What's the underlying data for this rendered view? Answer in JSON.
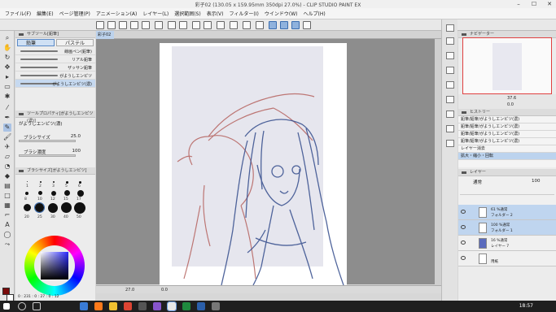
{
  "window": {
    "title": "彩子02 (130.05 x 159.95mm 350dpi 27.0%)  - CLIP STUDIO PAINT EX"
  },
  "menu": [
    "ファイル(F)",
    "編集(E)",
    "ページ管理(P)",
    "アニメーション(A)",
    "レイヤー(L)",
    "選択範囲(S)",
    "表示(V)",
    "フィルター(I)",
    "ウインドウ(W)",
    "ヘルプ(H)"
  ],
  "subtool": {
    "header": "サブツール[鉛筆]",
    "tabs": [
      "鉛筆",
      "パステル"
    ],
    "brushes": [
      "線画ペン(鉛筆)",
      "リアル鉛筆",
      "ザッサン鉛筆",
      "がようしエンピツ",
      "がようしエンピツ(濃)"
    ]
  },
  "toolprop": {
    "header": "ツールプロパティ[がようしエンピツ(濃)]",
    "brush_name": "がようしエンピツ(濃)",
    "size_label": "ブラシサイズ",
    "size_value": "25.0",
    "density_label": "ブラシ濃度",
    "density_value": "100"
  },
  "brushsize": {
    "header": "ブラシサイズ[がようしエンピツ]",
    "sizes": [
      "1",
      "2",
      "3",
      "5",
      "6",
      "8",
      "10",
      "12",
      "15",
      "17",
      "20",
      "25",
      "30",
      "40",
      "50"
    ]
  },
  "document": {
    "tab": "彩子02",
    "zoom": "27.0",
    "angle": "0.0"
  },
  "navigator": {
    "header": "ナビゲーター",
    "zoom": "37.6",
    "angle": "0.0"
  },
  "history": {
    "header": "ヒストリー",
    "items": [
      "鉛筆/鉛筆/がようしエンピツ(濃)",
      "鉛筆/鉛筆/がようしエンピツ(濃)",
      "鉛筆/鉛筆/がようしエンピツ(濃)",
      "鉛筆/鉛筆/がようしエンピツ(濃)",
      "レイヤー消去",
      "拡大・縮小・回転"
    ]
  },
  "layers": {
    "header": "レイヤー",
    "blend": "通常",
    "opacity": "100",
    "rows": [
      {
        "line1": "61 %通常",
        "line2": "フォルダー 2"
      },
      {
        "line1": "100 %通常",
        "line2": "フォルダー 1"
      },
      {
        "line1": "16 %通常",
        "line2": "レイヤー 7"
      },
      {
        "line1": "",
        "line2": "用紙"
      }
    ]
  },
  "color": {
    "values": "0 : 231 : 0 : 27 : 0 : 12"
  },
  "taskbar": {
    "time": "18:57"
  }
}
